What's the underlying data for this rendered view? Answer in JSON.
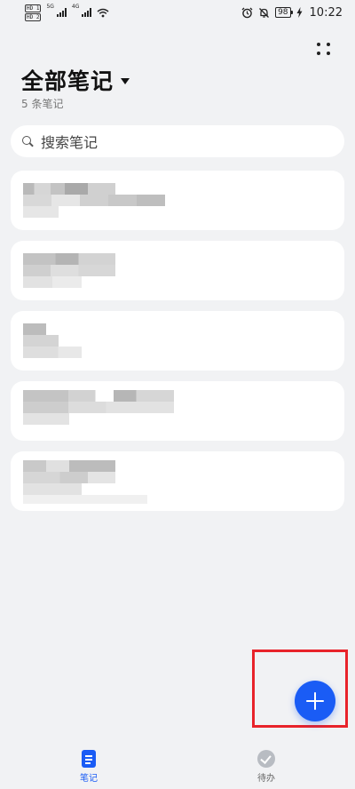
{
  "status_bar": {
    "sim1": "HD 1",
    "sim2": "HD 2",
    "net1": "5G",
    "net2": "4G",
    "battery": "98",
    "time": "10:22"
  },
  "header": {
    "title": "全部笔记",
    "count_label": "5 条笔记"
  },
  "search": {
    "placeholder": "搜索笔记"
  },
  "notes": [
    {
      "content": "redacted"
    },
    {
      "content": "redacted"
    },
    {
      "content": "redacted"
    },
    {
      "content": "redacted"
    },
    {
      "content": "redacted"
    }
  ],
  "bottom_nav": {
    "notes_label": "笔记",
    "todo_label": "待办"
  },
  "colors": {
    "accent": "#1a5cf5",
    "background": "#f1f2f4",
    "card": "#ffffff",
    "highlight": "#e8232a"
  },
  "icons": {
    "fab": "plus-icon",
    "search": "search-icon",
    "more": "more-dots-icon",
    "notes_tab": "note-document-icon",
    "todo_tab": "check-circle-icon"
  }
}
